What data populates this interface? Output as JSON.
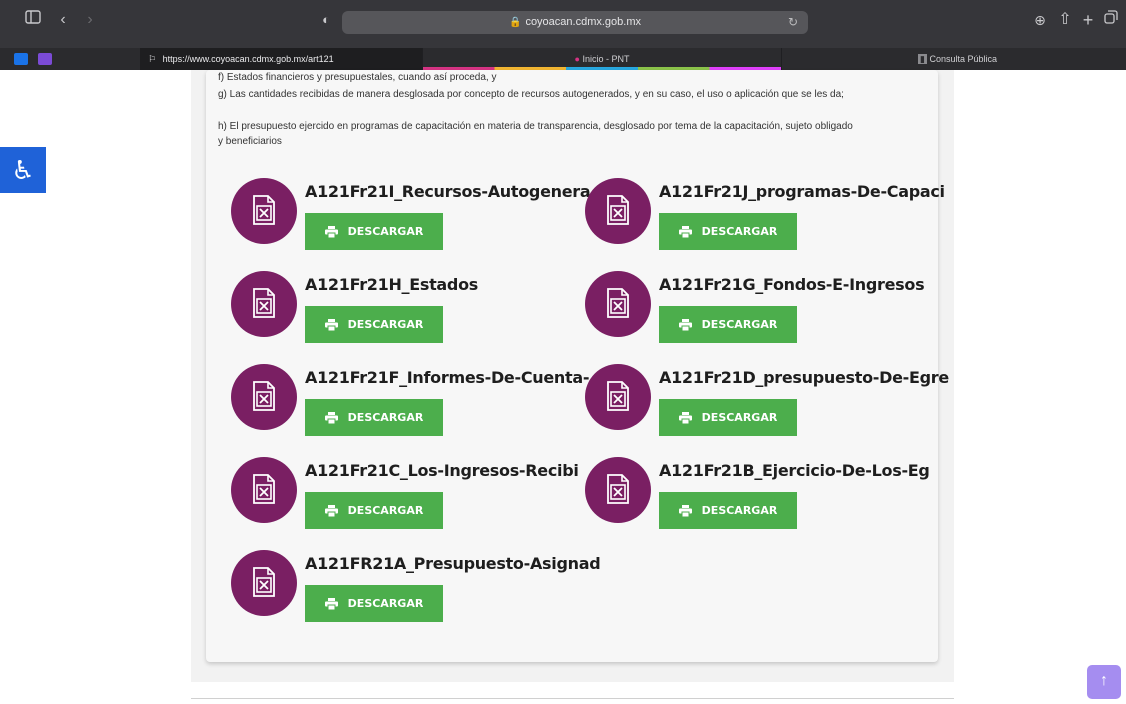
{
  "browser": {
    "url": "coyoacan.cdmx.gob.mx",
    "tabs": [
      {
        "label": "https://www.coyoacan.cdmx.gob.mx/art121"
      },
      {
        "label": "Inicio - PNT"
      },
      {
        "label": "Consulta Pública"
      }
    ]
  },
  "content": {
    "paragraphs": [
      "f) Estados financieros y presupuestales, cuando así proceda, y",
      "g) Las cantidades recibidas de manera desglosada por concepto de recursos autogenerados, y en su caso, el uso o aplicación que se les da;",
      "h) El presupuesto ejercido en programas de capacitación en materia de transparencia, desglosado por tema de la capacitación, sujeto obligado y beneficiarios"
    ],
    "download_label": "DESCARGAR",
    "files": [
      {
        "title": "A121Fr21I_Recursos-Autogenera"
      },
      {
        "title": "A121Fr21J_programas-De-Capaci"
      },
      {
        "title": "A121Fr21H_Estados"
      },
      {
        "title": "A121Fr21G_Fondos-E-Ingresos"
      },
      {
        "title": "A121Fr21F_Informes-De-Cuenta-"
      },
      {
        "title": "A121Fr21D_presupuesto-De-Egre"
      },
      {
        "title": "A121Fr21C_Los-Ingresos-Recibi"
      },
      {
        "title": "A121Fr21B_Ejercicio-De-Los-Eg"
      },
      {
        "title": "A121FR21A_Presupuesto-Asignad"
      }
    ]
  },
  "colors": {
    "file_icon_bg": "#7a1f63",
    "download_button": "#4cae4c",
    "accessibility_button": "#1f62d8",
    "scroll_top_button": "#a58df0"
  },
  "icons": {
    "accessibility": "wheelchair-icon",
    "file": "excel-file-icon",
    "download": "printer-icon",
    "scroll_top": "arrow-up-icon"
  }
}
